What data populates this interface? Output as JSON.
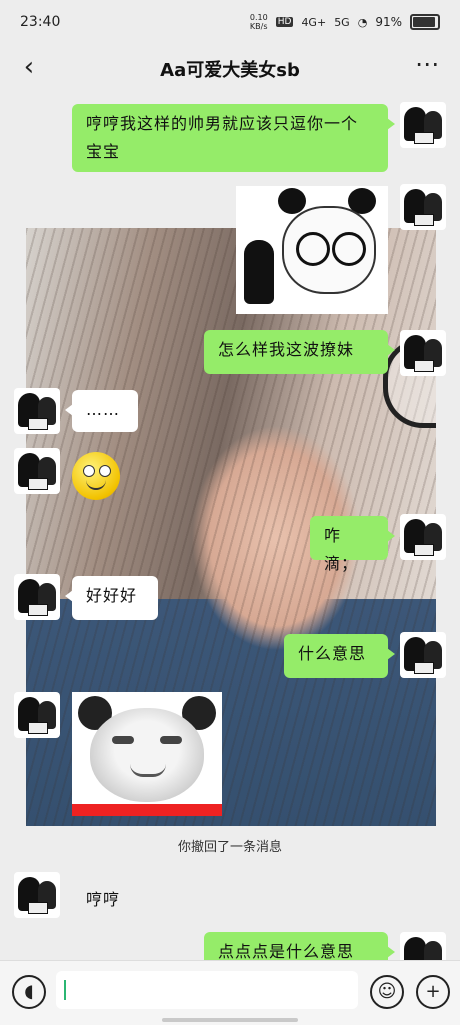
{
  "status": {
    "time": "23:40",
    "net_speed": "0.10\nKB/s",
    "hd": "HD",
    "signal_1": "4G+",
    "signal_2": "5G",
    "battery": "91%"
  },
  "nav": {
    "back": "‹",
    "title": "Aa可爱大美女sb",
    "more": "⋯"
  },
  "messages": {
    "m1": "哼哼我这样的帅男就应该只逗你一个宝宝",
    "m2": "怎么样我这波撩妹",
    "m3": "……",
    "m4": "咋滴；",
    "m5": "好好好",
    "m6": "什么意思",
    "recall": "你撤回了一条消息",
    "m7": "哼哼",
    "m8": "点点点是什么意思"
  },
  "colors": {
    "bubble_green": "#95ec69",
    "bubble_white": "#ffffff",
    "chat_bg": "#ededed"
  },
  "icons": {
    "voice": "voice-icon",
    "emoji": "emoji-icon",
    "plus": "plus-icon"
  }
}
